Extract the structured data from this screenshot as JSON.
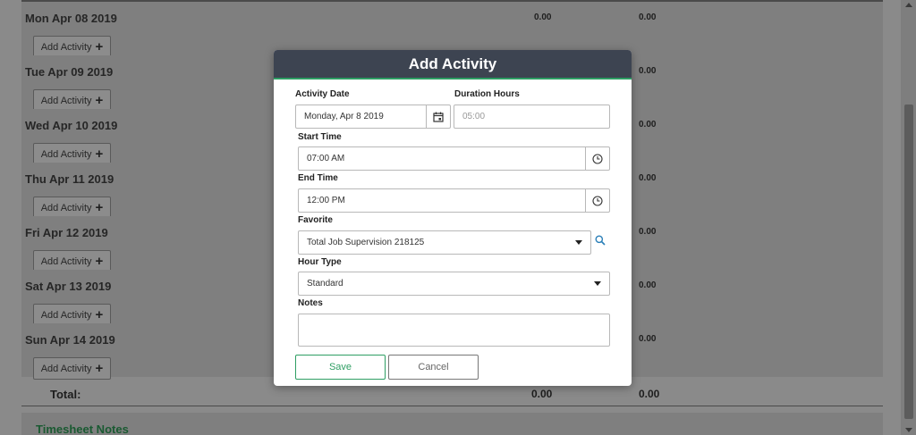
{
  "days": [
    {
      "title": "Mon Apr 08 2019",
      "v1": "0.00",
      "v2": "0.00"
    },
    {
      "title": "Tue Apr 09 2019",
      "v1": "",
      "v2": "0.00"
    },
    {
      "title": "Wed Apr 10 2019",
      "v1": "",
      "v2": "0.00"
    },
    {
      "title": "Thu Apr 11 2019",
      "v1": "",
      "v2": "0.00"
    },
    {
      "title": "Fri Apr 12 2019",
      "v1": "",
      "v2": "0.00"
    },
    {
      "title": "Sat Apr 13 2019",
      "v1": "",
      "v2": "0.00"
    },
    {
      "title": "Sun Apr 14 2019",
      "v1": "",
      "v2": "0.00"
    }
  ],
  "add_activity_label": "Add Activity",
  "add_activity_plus": "+",
  "total": {
    "label": "Total:",
    "v1": "0.00",
    "v2": "0.00"
  },
  "timesheet_notes_title": "Timesheet Notes",
  "modal": {
    "title": "Add Activity",
    "activity_date_label": "Activity Date",
    "activity_date_value": "Monday, Apr 8 2019",
    "duration_label": "Duration Hours",
    "duration_placeholder": "05:00",
    "start_time_label": "Start Time",
    "start_time_value": "07:00 AM",
    "end_time_label": "End Time",
    "end_time_value": "12:00 PM",
    "favorite_label": "Favorite",
    "favorite_value": "Total Job Supervision 218125",
    "hour_type_label": "Hour Type",
    "hour_type_value": "Standard",
    "notes_label": "Notes",
    "notes_value": "",
    "save_label": "Save",
    "cancel_label": "Cancel"
  },
  "colors": {
    "header_bg": "#3d4451",
    "accent": "#2e9e63",
    "search_icon": "#2a7fb8"
  },
  "icons": [
    "calendar-icon",
    "clock-icon",
    "search-icon",
    "chevron-down-icon"
  ]
}
